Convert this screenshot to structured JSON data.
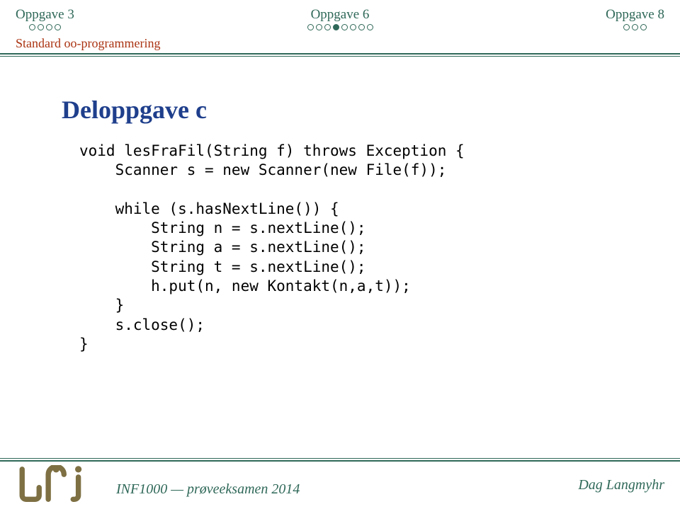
{
  "nav": {
    "items": [
      {
        "label": "Oppgave 3",
        "total": 4,
        "current": -1
      },
      {
        "label": "Oppgave 6",
        "total": 8,
        "current": 3
      },
      {
        "label": "Oppgave 8",
        "total": 3,
        "current": -1
      }
    ]
  },
  "section": {
    "label": "Standard oo-programmering"
  },
  "slide": {
    "title": "Deloppgave c",
    "code": "void lesFraFil(String f) throws Exception {\n    Scanner s = new Scanner(new File(f));\n\n    while (s.hasNextLine()) {\n        String n = s.nextLine();\n        String a = s.nextLine();\n        String t = s.nextLine();\n        h.put(n, new Kontakt(n,a,t));\n    }\n    s.close();\n}"
  },
  "footer": {
    "course": "INF1000 — prøveeksamen 2014",
    "author": "Dag Langmyhr"
  }
}
